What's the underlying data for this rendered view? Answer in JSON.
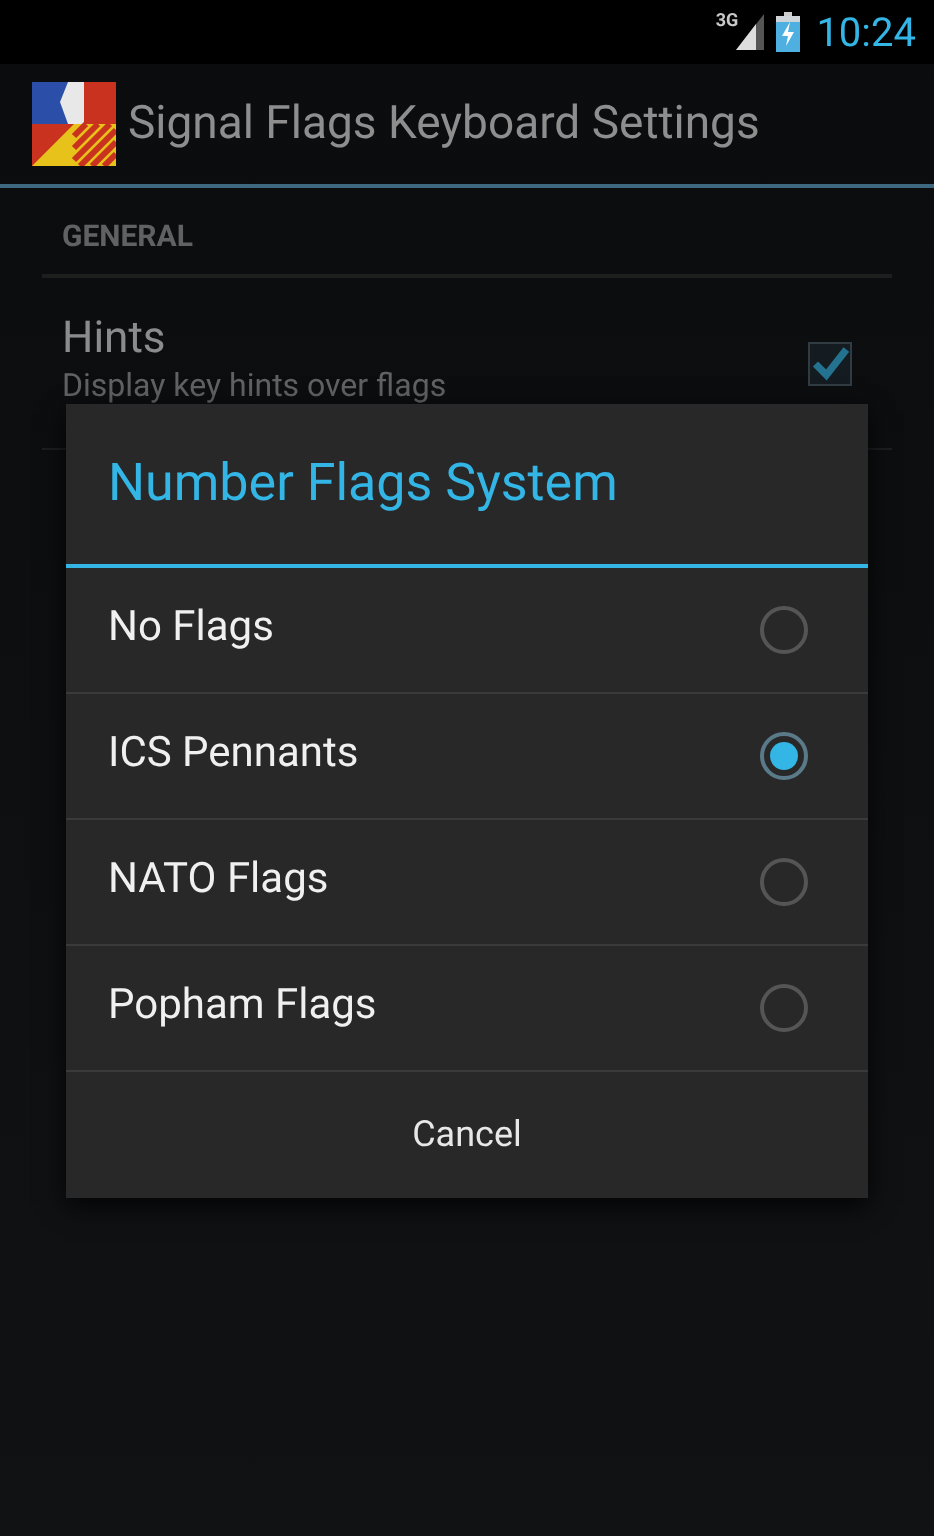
{
  "status_bar": {
    "network": "3G",
    "time": "10:24"
  },
  "action_bar": {
    "title": "Signal Flags Keyboard Settings"
  },
  "section": {
    "header": "GENERAL"
  },
  "preferences": [
    {
      "title": "Hints",
      "summary": "Display key hints over flags",
      "checked": true
    }
  ],
  "dialog": {
    "title": "Number Flags System",
    "options": [
      {
        "label": "No Flags",
        "selected": false
      },
      {
        "label": "ICS Pennants",
        "selected": true
      },
      {
        "label": "NATO Flags",
        "selected": false
      },
      {
        "label": "Popham Flags",
        "selected": false
      }
    ],
    "button": "Cancel"
  }
}
